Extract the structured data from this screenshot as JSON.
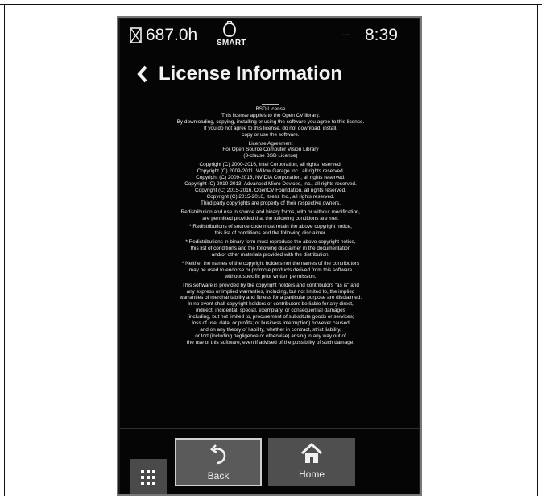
{
  "status": {
    "hours": "687.0h",
    "smart_label": "SMART",
    "signal": "--",
    "time": "8:39"
  },
  "header": {
    "title": "License Information"
  },
  "license": {
    "paragraphs": [
      [
        "BSD License",
        "This license applies to the Open CV library.",
        "By downloading, copying, installing or using the software you agree to this license.",
        "If you do not agree to this license, do not download, install,",
        "copy or use the software."
      ],
      [
        "License Agreement",
        "For Open Source Computer Vision Library",
        "(3-clause BSD License)"
      ],
      [
        "Copyright (C) 2000-2016, Intel Corporation, all rights reserved.",
        "Copyright (C) 2009-2011, Willow Garage Inc., all rights reserved.",
        "Copyright (C) 2009-2016, NVIDIA Corporation, all rights reserved.",
        "Copyright (C) 2010-2013, Advanced Micro Devices, Inc., all rights reserved.",
        "Copyright (C) 2015-2016, OpenCV Foundation, all rights reserved.",
        "Copyright (C) 2015-2016, Itseez Inc., all rights reserved.",
        "Third party copyrights are property of their respective owners."
      ],
      [
        "Redistribution and use in source and binary forms, with or without modification,",
        "are permitted provided that the following conditions are met:"
      ],
      [
        "* Redistributions of source code must retain the above copyright notice,",
        "this list of conditions and the following disclaimer."
      ],
      [
        "* Redistributions in binary form must reproduce the above copyright notice,",
        "this list of conditions and the following disclaimer in the documentation",
        "and/or other materials provided with the distribution."
      ],
      [
        "* Neither the names of the copyright holders nor the names of the contributors",
        "may be used to endorse or promote products derived from this software",
        "without specific prior written permission."
      ],
      [
        "This software is provided by the copyright holders and contributors \"as is\" and",
        "any express or implied warranties, including, but not limited to, the implied",
        "warranties of merchantability and fitness for a particular purpose are disclaimed.",
        "In no event shall copyright holders or contributors be liable for any direct,",
        "indirect, incidental, special, exemplary, or consequential damages",
        "(including, but not limited to, procurement of substitute goods or services;",
        "loss of use, data, or profits; or business interruption) however caused",
        "and on any theory of liability, whether in contract, strict liability,",
        "or tort (including negligence or otherwise) arising in any way out of",
        "the use of this software, even if advised of the possibility of such damage."
      ]
    ]
  },
  "nav": {
    "back_label": "Back",
    "home_label": "Home"
  },
  "icons": {
    "status_left": "hourglass-icon",
    "status_center": "smart-bell-icon",
    "header": "back-chevron-icon",
    "menu": "grid-icon",
    "back": "undo-arrow-icon",
    "home": "home-icon"
  }
}
